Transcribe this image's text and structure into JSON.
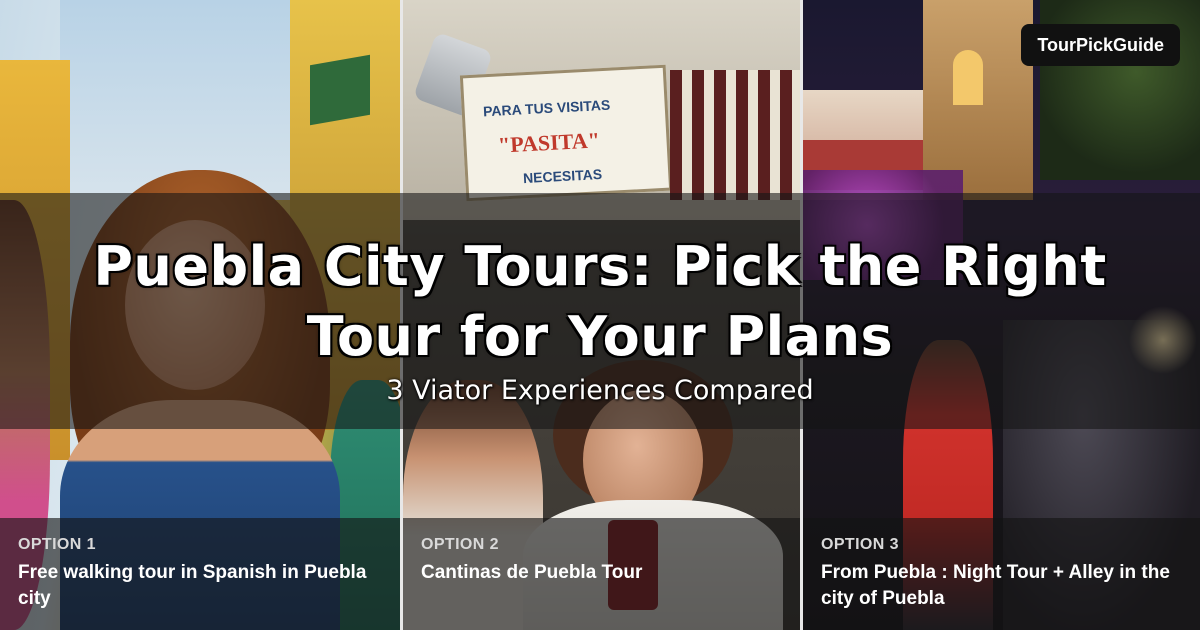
{
  "brand": {
    "label": "TourPickGuide"
  },
  "hero": {
    "title": "Puebla City Tours: Pick the Right Tour for Your Plans",
    "subtitle": "3 Viator Experiences Compared"
  },
  "photo_text": {
    "sign_line1": "PARA TUS VISITAS",
    "sign_line2": "\"PASITA\"",
    "sign_line3": "NECESITAS"
  },
  "options": [
    {
      "kicker": "OPTION 1",
      "title": "Free walking tour in Spanish in Puebla city"
    },
    {
      "kicker": "OPTION 2",
      "title": "Cantinas de Puebla Tour"
    },
    {
      "kicker": "OPTION 3",
      "title": "From Puebla : Night Tour + Alley in the city of Puebla"
    }
  ],
  "colors": {
    "overlay": "#141414",
    "text": "#ffffff",
    "badge_bg": "#111111",
    "divider": "#e8e8e8"
  }
}
